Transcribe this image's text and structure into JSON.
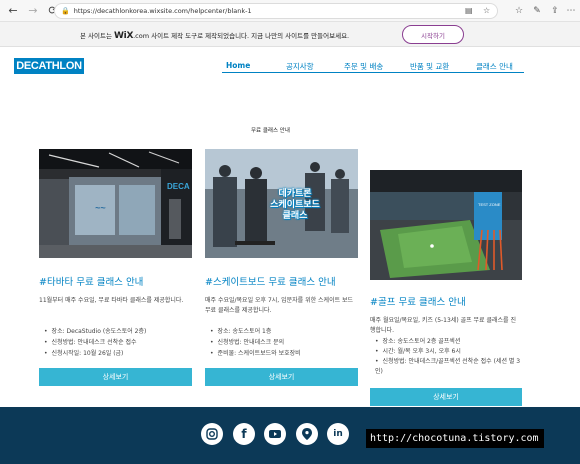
{
  "browser": {
    "url": "https://decathlonkorea.wixsite.com/helpcenter/blank-1"
  },
  "wix_banner": {
    "prefix": "본 사이트는 ",
    "brand": "WiX",
    "suffix": ".com 사이트 제작 도구로 제작되었습니다. 지금 나만의 사이트를 만들어보세요.",
    "cta": "시작하기"
  },
  "site": {
    "logo": "DECATHLON",
    "nav": [
      "Home",
      "공지사항",
      "주문 및 배송",
      "반품 및 교환",
      "클래스 안내"
    ],
    "section_title": "무료 클래스 안내"
  },
  "cards": [
    {
      "title": "#타바타 무료 클래스 안내",
      "desc": "11월부터 매주 수요일, 무료 타바타 클래스를 제공합니다.",
      "items": [
        "장소: DecaStudio (송도스토어 2층)",
        "신청방법: 안내데스크 선착순 접수",
        "신청시작일: 10월 26일 (금)"
      ],
      "button": "상세보기"
    },
    {
      "title": "#스케이트보드 무료 클래스 안내",
      "desc": "매주 수요일/목요일 오후 7시, 입문자를 위한 스케이트 보드 무료 클래스를 제공합니다.",
      "items": [
        "장소: 송도스토어 1층",
        "신청방법: 안내데스크 문의",
        "준비물: 스케이트보드와 보호장비"
      ],
      "button": "상세보기",
      "photo_caption": [
        "데카트론",
        "스케이트보드",
        "클래스"
      ]
    },
    {
      "title": "#골프 무료 클래스 안내",
      "desc": "매주 월요일/목요일, 키즈 (5-13세) 골프 무료 클래스를 진행합니다.",
      "items": [
        "장소: 송도스토어 2층 골프섹션",
        "시간: 월/목 오후 3시, 오후 6시",
        "신청방법: 안내데스크/골프섹션 선착순 접수 (세션 별 3인)"
      ],
      "button": "상세보기"
    }
  ],
  "footer": {
    "social": [
      "instagram-icon",
      "facebook-icon",
      "youtube-icon",
      "map-pin-icon",
      "linkedin-icon"
    ],
    "watermark": "http://chocotuna.tistory.com"
  },
  "colors": {
    "brand": "#0082c3",
    "button": "#36b5d3",
    "footer": "#0c3957",
    "wix": "#8a3e91"
  }
}
